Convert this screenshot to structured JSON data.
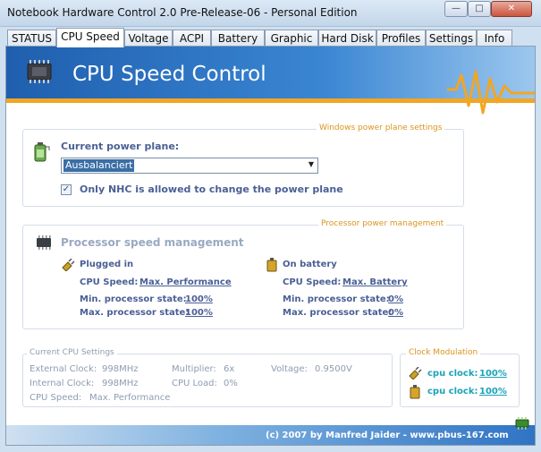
{
  "window": {
    "title": "Notebook Hardware Control 2.0 Pre-Release-06  -  Personal Edition",
    "min_label": "—",
    "max_label": "□",
    "close_label": "✕"
  },
  "tabs": [
    {
      "label": "STATUS"
    },
    {
      "label": "CPU Speed"
    },
    {
      "label": "Voltage"
    },
    {
      "label": "ACPI"
    },
    {
      "label": "Battery"
    },
    {
      "label": "Graphic"
    },
    {
      "label": "Hard Disk"
    },
    {
      "label": "Profiles"
    },
    {
      "label": "Settings"
    },
    {
      "label": "Info"
    }
  ],
  "active_tab": "CPU Speed",
  "banner": {
    "title": "CPU Speed Control"
  },
  "power_plane": {
    "legend": "Windows power plane settings",
    "label": "Current power plane:",
    "selected": "Ausbalanciert",
    "checkbox_label": "Only NHC is allowed to change the power plane",
    "checkbox_checked": true
  },
  "processor": {
    "legend": "Processor power management",
    "title": "Processor speed management",
    "plugged": {
      "heading": "Plugged in",
      "cpu_speed_label": "CPU Speed:",
      "cpu_speed_value": "Max. Performance",
      "min_label": "Min. processor state:",
      "min_value": "100%",
      "max_label": "Max. processor state:",
      "max_value": "100%"
    },
    "battery": {
      "heading": "On battery",
      "cpu_speed_label": "CPU Speed:",
      "cpu_speed_value": "Max. Battery",
      "min_label": "Min. processor state:",
      "min_value": "0%",
      "max_label": "Max. processor state:",
      "max_value": "0%"
    }
  },
  "current": {
    "legend": "Current CPU Settings",
    "external_clock_label": "External Clock:",
    "external_clock_value": "998MHz",
    "internal_clock_label": "Internal Clock:",
    "internal_clock_value": "998MHz",
    "multiplier_label": "Multiplier:",
    "multiplier_value": "6x",
    "cpu_load_label": "CPU Load:",
    "cpu_load_value": "0%",
    "voltage_label": "Voltage:",
    "voltage_value": "0.9500V",
    "cpu_speed_label": "CPU Speed:",
    "cpu_speed_value": "Max. Performance"
  },
  "clock_mod": {
    "legend": "Clock Modulation",
    "rows": [
      {
        "label": "cpu clock:",
        "value": "100%"
      },
      {
        "label": "cpu clock:",
        "value": "100%"
      }
    ]
  },
  "footer": {
    "text": "(c) 2007 by Manfred Jaider - www.pbus-167.com"
  },
  "colors": {
    "accent_orange": "#f1a624",
    "banner_blue": "#1f5fae",
    "label_blue": "#4a5f95",
    "link_cyan": "#1aa3b8"
  },
  "icons": {
    "chip": "cpu-chip-icon",
    "battery_plug": "battery-plug-icon",
    "wave": "heartbeat-wave-icon",
    "plug": "plug-icon",
    "battery": "battery-icon"
  }
}
